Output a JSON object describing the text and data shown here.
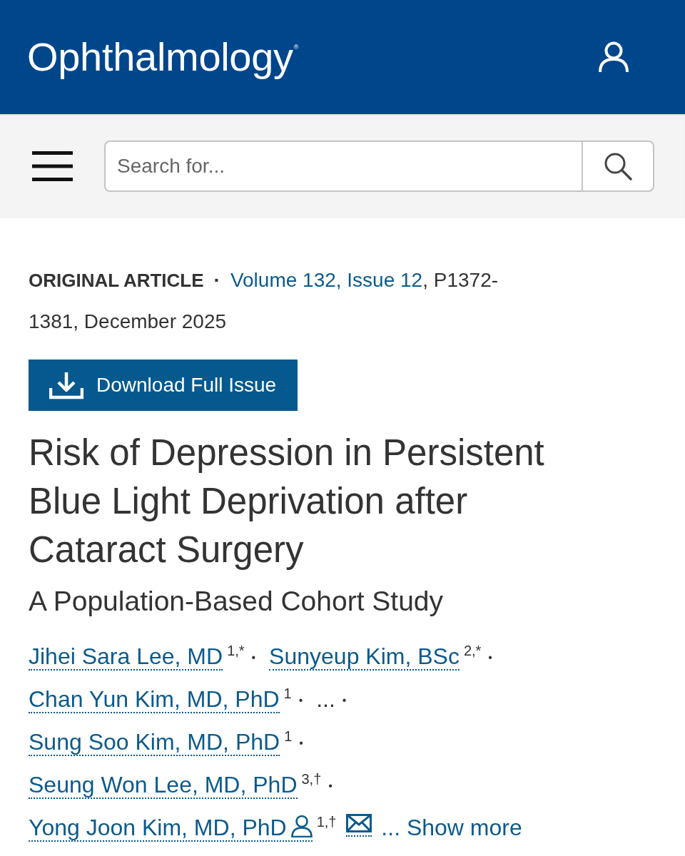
{
  "header": {
    "logo": "Ophthalmology",
    "logo_mark": "®"
  },
  "toolbar": {
    "search": {
      "placeholder": "Search for..."
    }
  },
  "article": {
    "type_label": "ORIGINAL ARTICLE",
    "separator": "·",
    "issue_link": "Volume 132, Issue 12",
    "citation": ", P1372-1381, December 2025",
    "download_button": "Download Full Issue",
    "title": "Risk of Depression in Persistent Blue Light Deprivation after Cataract Surgery",
    "subtitle": "A Population-Based Cohort Study",
    "authors": [
      {
        "kind": "author",
        "name": "Jihei Sara Lee, MD",
        "affiliations": "1,*",
        "corresponding": false,
        "email": false,
        "separator": "•"
      },
      {
        "kind": "author",
        "name": "Sunyeup Kim, BSc",
        "affiliations": "2,*",
        "corresponding": false,
        "email": false,
        "separator": "•"
      },
      {
        "kind": "author",
        "name": "Chan Yun Kim, MD, PhD",
        "affiliations": "1",
        "corresponding": false,
        "email": false,
        "separator": "•"
      },
      {
        "kind": "ellipsis",
        "text": "...",
        "separator": "•"
      },
      {
        "kind": "author",
        "name": "Sung Soo Kim, MD, PhD",
        "affiliations": "1",
        "corresponding": false,
        "email": false,
        "separator": "•"
      },
      {
        "kind": "author",
        "name": "Seung Won Lee, MD, PhD",
        "affiliations": "3,†",
        "corresponding": false,
        "email": false,
        "separator": "•"
      },
      {
        "kind": "author",
        "name": "Yong Joon Kim, MD, PhD",
        "affiliations": "1,†",
        "corresponding": true,
        "email": true
      }
    ],
    "show_more": "... Show more"
  }
}
